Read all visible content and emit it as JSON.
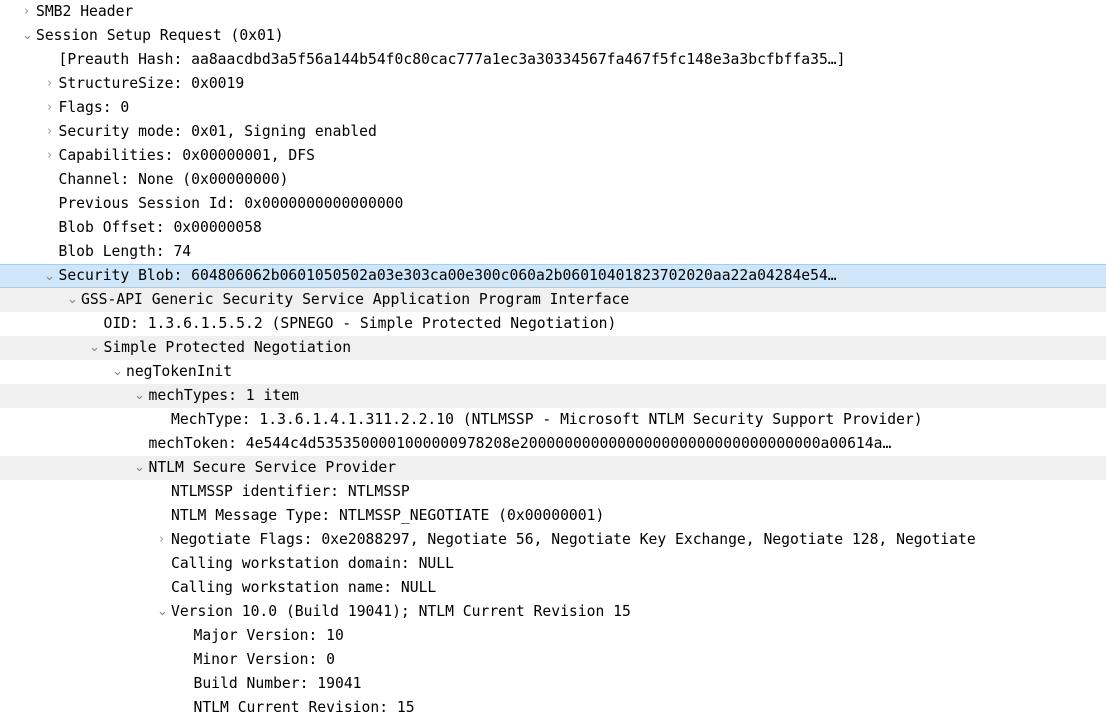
{
  "panel": {
    "name": "packet-details-tree",
    "app": "Wireshark Packet Details",
    "selected_row_index": 11,
    "colors": {
      "background": "#ffffff",
      "alt_row": "#f0f0f0",
      "selection": "#cfe5f8",
      "selection_border": "#a8cdec",
      "text": "#000000",
      "expander": "#888888"
    },
    "expander_glyphs": {
      "collapsed": "›",
      "expanded": "⌄"
    }
  },
  "rows": [
    {
      "indent": 1,
      "state": "collapsed",
      "text": "SMB2 Header",
      "alt": false
    },
    {
      "indent": 1,
      "state": "expanded",
      "text": "Session Setup Request (0x01)",
      "alt": false
    },
    {
      "indent": 2,
      "state": "leaf",
      "text": "[Preauth Hash: aa8aacdbd3a5f56a144b54f0c80cac777a1ec3a30334567fa467f5fc148e3a3bcfbffa35…]",
      "alt": false
    },
    {
      "indent": 2,
      "state": "collapsed",
      "text": "StructureSize: 0x0019",
      "alt": false
    },
    {
      "indent": 2,
      "state": "collapsed",
      "text": "Flags: 0",
      "alt": false
    },
    {
      "indent": 2,
      "state": "collapsed",
      "text": "Security mode: 0x01, Signing enabled",
      "alt": false
    },
    {
      "indent": 2,
      "state": "collapsed",
      "text": "Capabilities: 0x00000001, DFS",
      "alt": false
    },
    {
      "indent": 2,
      "state": "leaf",
      "text": "Channel: None (0x00000000)",
      "alt": false
    },
    {
      "indent": 2,
      "state": "leaf",
      "text": "Previous Session Id: 0x0000000000000000",
      "alt": false
    },
    {
      "indent": 2,
      "state": "leaf",
      "text": "Blob Offset: 0x00000058",
      "alt": false
    },
    {
      "indent": 2,
      "state": "leaf",
      "text": "Blob Length: 74",
      "alt": false
    },
    {
      "indent": 2,
      "state": "expanded",
      "text": "Security Blob: 604806062b0601050502a03e303ca00e300c060a2b06010401823702020aa22a04284e54…",
      "alt": false,
      "selected": true
    },
    {
      "indent": 3,
      "state": "expanded",
      "text": "GSS-API Generic Security Service Application Program Interface",
      "alt": true
    },
    {
      "indent": 4,
      "state": "leaf",
      "text": "OID: 1.3.6.1.5.5.2 (SPNEGO - Simple Protected Negotiation)",
      "alt": false
    },
    {
      "indent": 4,
      "state": "expanded",
      "text": "Simple Protected Negotiation",
      "alt": true
    },
    {
      "indent": 5,
      "state": "expanded",
      "text": "negTokenInit",
      "alt": false
    },
    {
      "indent": 6,
      "state": "expanded",
      "text": "mechTypes: 1 item",
      "alt": true
    },
    {
      "indent": 7,
      "state": "leaf",
      "text": "MechType: 1.3.6.1.4.1.311.2.2.10 (NTLMSSP - Microsoft NTLM Security Support Provider)",
      "alt": false
    },
    {
      "indent": 6,
      "state": "leaf",
      "text": "mechToken: 4e544c4d5353500001000000978208e2000000000000000000000000000000000a00614a…",
      "alt": false
    },
    {
      "indent": 6,
      "state": "expanded",
      "text": "NTLM Secure Service Provider",
      "alt": true
    },
    {
      "indent": 7,
      "state": "leaf",
      "text": "NTLMSSP identifier: NTLMSSP",
      "alt": false
    },
    {
      "indent": 7,
      "state": "leaf",
      "text": "NTLM Message Type: NTLMSSP_NEGOTIATE (0x00000001)",
      "alt": false
    },
    {
      "indent": 7,
      "state": "collapsed",
      "text": "Negotiate Flags: 0xe2088297, Negotiate 56, Negotiate Key Exchange, Negotiate 128, Negotiate",
      "alt": false
    },
    {
      "indent": 7,
      "state": "leaf",
      "text": "Calling workstation domain: NULL",
      "alt": false
    },
    {
      "indent": 7,
      "state": "leaf",
      "text": "Calling workstation name: NULL",
      "alt": false
    },
    {
      "indent": 7,
      "state": "expanded",
      "text": "Version 10.0 (Build 19041); NTLM Current Revision 15",
      "alt": false
    },
    {
      "indent": 8,
      "state": "leaf",
      "text": "Major Version: 10",
      "alt": false
    },
    {
      "indent": 8,
      "state": "leaf",
      "text": "Minor Version: 0",
      "alt": false
    },
    {
      "indent": 8,
      "state": "leaf",
      "text": "Build Number: 19041",
      "alt": false
    },
    {
      "indent": 8,
      "state": "leaf",
      "text": "NTLM Current Revision: 15",
      "alt": false
    }
  ]
}
